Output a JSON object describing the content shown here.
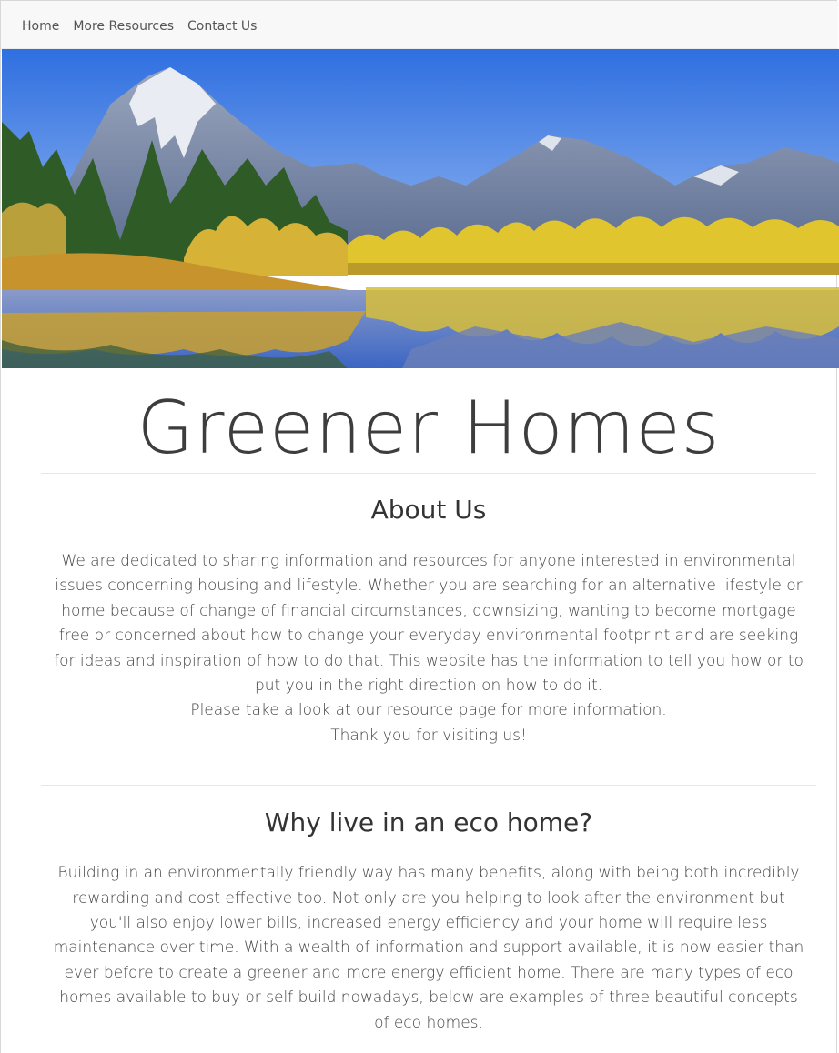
{
  "navbar": {
    "items": [
      {
        "label": "Home"
      },
      {
        "label": "More Resources"
      },
      {
        "label": "Contact Us"
      }
    ]
  },
  "hero": {
    "image": "mountain-lake-landscape",
    "colors": {
      "sky": "#3f7fe3",
      "mountain": "#7f8ea8",
      "snow": "#e8ecf2",
      "trees_dark": "#2e5a23",
      "trees_yellow": "#e2c633",
      "meadow": "#c79b2e",
      "water": "#5c7fc6"
    }
  },
  "site": {
    "title": "Greener Homes"
  },
  "about": {
    "heading": "About Us",
    "body": "We are dedicated to sharing information and resources for anyone interested in environmental issues concerning housing and lifestyle. Whether you are searching for an alternative lifestyle or home because of change of financial circumstances, downsizing, wanting to become mortgage free or concerned about how to change your everyday environmental footprint and are seeking for ideas and inspiration of how to do that. This website has the information to tell you how or to put you in the right direction on how to do it.",
    "line2": "Please take a look at our resource page for more information.",
    "line3": "Thank you for visiting us!"
  },
  "why": {
    "heading": "Why live in an eco home?",
    "body": "Building in an environmentally friendly way has many benefits, along with being both incredibly rewarding and cost effective too. Not only are you helping to look after the environment but you'll also enjoy lower bills, increased energy efficiency and your home will require less maintenance over time. With a wealth of information and support available, it is now easier than ever before to create a greener and more energy efficient home. There are many types of eco homes available to buy or self build nowadays, below are examples of three beautiful concepts of eco homes."
  }
}
